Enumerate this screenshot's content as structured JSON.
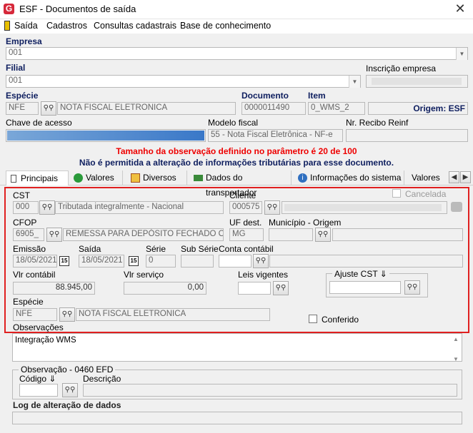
{
  "window": {
    "title": "ESF - Documentos de saída",
    "app_icon": "G",
    "close_glyph": "✕"
  },
  "menu": [
    "Saída",
    "Cadastros",
    "Consultas cadastrais",
    "Base de conhecimento"
  ],
  "header": {
    "empresa_label": "Empresa",
    "empresa_value": "001",
    "filial_label": "Filial",
    "filial_value": "001",
    "inscricao_label": "Inscrição empresa",
    "especie_label": "Espécie",
    "especie_code": "NFE",
    "especie_desc": "NOTA FISCAL ELETRONICA",
    "documento_label": "Documento",
    "documento_value": "0000011490",
    "item_label": "Item",
    "item_value": "0_WMS_2",
    "origem_text": "Origem: ESF",
    "chave_label": "Chave de acesso",
    "modelo_label": "Modelo fiscal",
    "modelo_value": "55 - Nota Fiscal Eletrônica - NF-e",
    "recibo_label": "Nr. Recibo Reinf",
    "msg_red": "Tamanho da observação definido no parâmetro é 20 de 100",
    "msg_blue": "Não é permitida a alteração de informações tributárias para esse documento."
  },
  "tabs": [
    "Principais",
    "Valores",
    "Diversos",
    "Dados do transportador",
    "Informações do sistema",
    "Valores de"
  ],
  "main": {
    "cst_label": "CST",
    "cst_code": "000",
    "cst_desc": "Tributada integralmente - Nacional",
    "cliente_label": "Cliente",
    "cliente_code": "000575",
    "cancelada_label": "Cancelada",
    "cfop_label": "CFOP",
    "cfop_code": "6905_",
    "cfop_desc": "REMESSA PARA DEPÓSITO FECHADO OU A",
    "uf_label": "UF dest.",
    "uf_value": "MG",
    "municipio_label": "Município - Origem",
    "emissao_label": "Emissão",
    "emissao_value": "18/05/2021",
    "saida_label": "Saída",
    "saida_value": "18/05/2021",
    "serie_label": "Série",
    "serie_value": "0",
    "subserie_label": "Sub Série",
    "conta_label": "Conta contábil",
    "vlr_contabil_label": "Vlr contábil",
    "vlr_contabil_value": "88.945,00",
    "vlr_servico_label": "Vlr serviço",
    "vlr_servico_value": "0,00",
    "leis_label": "Leis vigentes",
    "ajuste_label": "Ajuste CST ⇓",
    "especie_label": "Espécie",
    "especie_code": "NFE",
    "especie_desc": "NOTA FISCAL ELETRONICA",
    "conferido_label": "Conferido",
    "observacoes_label": "Observações"
  },
  "lower": {
    "obs_text": "Integração WMS",
    "obs0460_label": "Observação - 0460 EFD",
    "codigo_label": "Código ⇓",
    "descricao_label": "Descrição",
    "log_label": "Log de alteração de dados"
  },
  "icons": {
    "binoculars": "binoculars-icon",
    "calendar_glyph": "15"
  },
  "colors": {
    "frame": "#e02020",
    "msg_red": "#e00000",
    "label_blue": "#102060"
  }
}
